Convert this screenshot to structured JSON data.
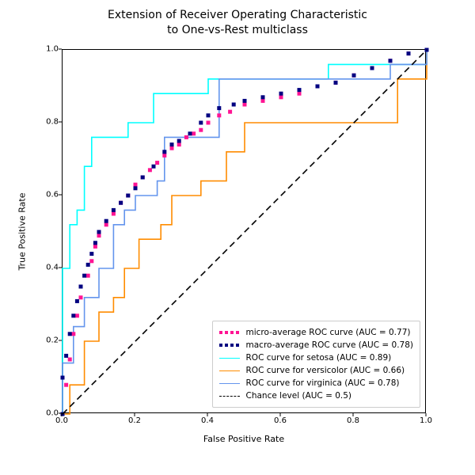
{
  "title_line1": "Extension of Receiver Operating Characteristic",
  "title_line2": "to One-vs-Rest multiclass",
  "xlabel": "False Positive Rate",
  "ylabel": "True Positive Rate",
  "ticks": [
    "0.0",
    "0.2",
    "0.4",
    "0.6",
    "0.8",
    "1.0"
  ],
  "legend": {
    "micro": "micro-average ROC curve (AUC = 0.77)",
    "macro": "macro-average ROC curve (AUC = 0.78)",
    "setosa": "ROC curve for setosa (AUC = 0.89)",
    "versi": "ROC curve for versicolor (AUC = 0.66)",
    "virgi": "ROC curve for virginica (AUC = 0.78)",
    "chance": "Chance level (AUC = 0.5)"
  },
  "colors": {
    "micro": "#ff1493",
    "macro": "#000080",
    "setosa": "#00ffff",
    "versi": "#ff8c00",
    "virgi": "#6495ed",
    "chance": "#000000"
  },
  "chart_data": {
    "type": "line",
    "title": "Extension of Receiver Operating Characteristic to One-vs-Rest multiclass",
    "xlabel": "False Positive Rate",
    "ylabel": "True Positive Rate",
    "xlim": [
      0.0,
      1.0
    ],
    "ylim": [
      0.0,
      1.0
    ],
    "diagonal": {
      "x": [
        0,
        1
      ],
      "y": [
        0,
        1
      ],
      "label": "Chance level (AUC = 0.5)"
    },
    "series": [
      {
        "name": "micro-average ROC curve (AUC = 0.77)",
        "style": "dotted",
        "x": [
          0.0,
          0.01,
          0.02,
          0.03,
          0.04,
          0.05,
          0.07,
          0.08,
          0.09,
          0.1,
          0.12,
          0.14,
          0.16,
          0.18,
          0.2,
          0.22,
          0.24,
          0.26,
          0.28,
          0.3,
          0.32,
          0.34,
          0.36,
          0.38,
          0.4,
          0.43,
          0.46,
          0.5,
          0.55,
          0.6,
          0.65,
          0.7,
          0.75,
          0.8,
          0.85,
          0.9,
          0.95,
          1.0
        ],
        "y": [
          0.0,
          0.08,
          0.15,
          0.22,
          0.27,
          0.32,
          0.38,
          0.42,
          0.46,
          0.49,
          0.52,
          0.55,
          0.58,
          0.6,
          0.63,
          0.65,
          0.67,
          0.69,
          0.71,
          0.73,
          0.74,
          0.76,
          0.77,
          0.78,
          0.8,
          0.82,
          0.83,
          0.85,
          0.86,
          0.87,
          0.88,
          0.9,
          0.91,
          0.93,
          0.95,
          0.97,
          0.99,
          1.0
        ]
      },
      {
        "name": "macro-average ROC curve (AUC = 0.78)",
        "style": "dotted",
        "x": [
          0.0,
          0.0,
          0.01,
          0.02,
          0.03,
          0.04,
          0.05,
          0.06,
          0.07,
          0.08,
          0.09,
          0.1,
          0.12,
          0.14,
          0.16,
          0.18,
          0.2,
          0.22,
          0.25,
          0.28,
          0.3,
          0.32,
          0.35,
          0.38,
          0.4,
          0.43,
          0.47,
          0.5,
          0.55,
          0.6,
          0.65,
          0.7,
          0.75,
          0.8,
          0.85,
          0.9,
          0.95,
          1.0
        ],
        "y": [
          0.0,
          0.1,
          0.16,
          0.22,
          0.27,
          0.31,
          0.35,
          0.38,
          0.41,
          0.44,
          0.47,
          0.5,
          0.53,
          0.56,
          0.58,
          0.6,
          0.62,
          0.65,
          0.68,
          0.72,
          0.74,
          0.75,
          0.77,
          0.8,
          0.82,
          0.84,
          0.85,
          0.86,
          0.87,
          0.88,
          0.89,
          0.9,
          0.91,
          0.93,
          0.95,
          0.97,
          0.99,
          1.0
        ]
      },
      {
        "name": "ROC curve for setosa (AUC = 0.89)",
        "style": "step",
        "x": [
          0.0,
          0.0,
          0.02,
          0.02,
          0.04,
          0.04,
          0.06,
          0.06,
          0.08,
          0.08,
          0.12,
          0.12,
          0.18,
          0.18,
          0.25,
          0.25,
          0.4,
          0.4,
          0.73,
          0.73,
          1.0,
          1.0
        ],
        "y": [
          0.0,
          0.4,
          0.4,
          0.52,
          0.52,
          0.56,
          0.56,
          0.68,
          0.68,
          0.76,
          0.76,
          0.76,
          0.76,
          0.8,
          0.8,
          0.88,
          0.88,
          0.92,
          0.92,
          0.96,
          0.96,
          1.0
        ]
      },
      {
        "name": "ROC curve for versicolor (AUC = 0.66)",
        "style": "step",
        "x": [
          0.0,
          0.02,
          0.02,
          0.06,
          0.06,
          0.1,
          0.1,
          0.14,
          0.14,
          0.17,
          0.17,
          0.21,
          0.21,
          0.27,
          0.27,
          0.3,
          0.3,
          0.38,
          0.38,
          0.45,
          0.45,
          0.5,
          0.5,
          0.7,
          0.7,
          0.92,
          0.92,
          1.0,
          1.0
        ],
        "y": [
          0.0,
          0.0,
          0.08,
          0.08,
          0.2,
          0.2,
          0.28,
          0.28,
          0.32,
          0.32,
          0.4,
          0.4,
          0.48,
          0.48,
          0.52,
          0.52,
          0.6,
          0.6,
          0.64,
          0.64,
          0.72,
          0.72,
          0.8,
          0.8,
          0.8,
          0.8,
          0.92,
          0.92,
          1.0
        ]
      },
      {
        "name": "ROC curve for virginica (AUC = 0.78)",
        "style": "step",
        "x": [
          0.0,
          0.0,
          0.03,
          0.03,
          0.06,
          0.06,
          0.1,
          0.1,
          0.14,
          0.14,
          0.17,
          0.17,
          0.2,
          0.2,
          0.26,
          0.26,
          0.28,
          0.28,
          0.3,
          0.3,
          0.43,
          0.43,
          0.8,
          0.8,
          0.9,
          0.9,
          1.0,
          1.0
        ],
        "y": [
          0.0,
          0.14,
          0.14,
          0.24,
          0.24,
          0.32,
          0.32,
          0.4,
          0.4,
          0.52,
          0.52,
          0.56,
          0.56,
          0.6,
          0.6,
          0.64,
          0.64,
          0.76,
          0.76,
          0.76,
          0.76,
          0.92,
          0.92,
          0.92,
          0.92,
          0.96,
          0.96,
          1.0
        ]
      }
    ]
  }
}
